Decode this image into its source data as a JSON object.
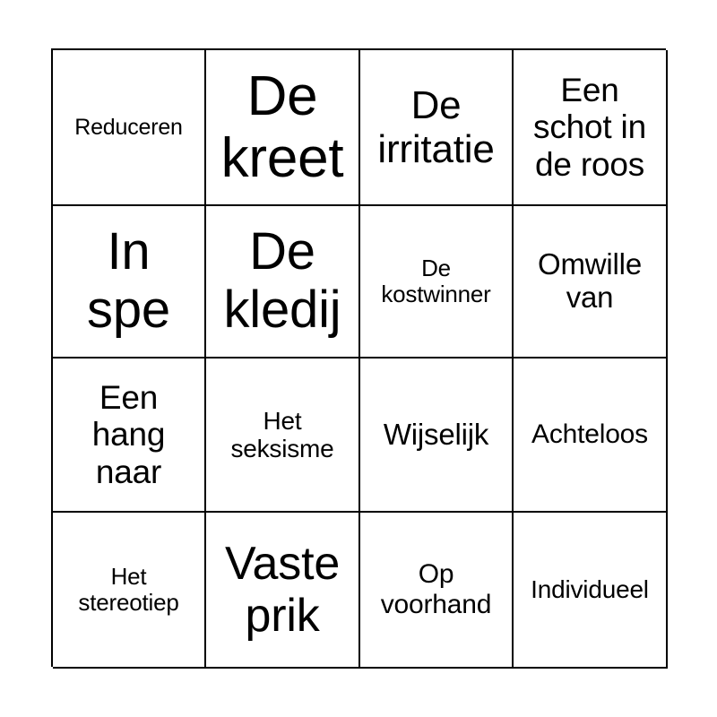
{
  "card": {
    "type": "bingo-card",
    "columns": 4,
    "rows": 4,
    "background_color": "#ffffff",
    "border_color": "#000000",
    "text_color": "#000000",
    "cells": [
      {
        "text": "Reduceren",
        "size": "s-xs",
        "row": 1,
        "col": 1
      },
      {
        "text": "De\nkreet",
        "size": "s-4xl",
        "row": 1,
        "col": 2
      },
      {
        "text": "De\nirritatie",
        "size": "s-xl",
        "row": 1,
        "col": 3
      },
      {
        "text": "Een\nschot in\nde roos",
        "size": "s-lg",
        "row": 1,
        "col": 4
      },
      {
        "text": "In\nspe",
        "size": "s-3xl",
        "row": 2,
        "col": 1
      },
      {
        "text": "De\nkledij",
        "size": "s-3xl",
        "row": 2,
        "col": 2
      },
      {
        "text": "De\nkostwinner",
        "size": "s-sm",
        "row": 2,
        "col": 3
      },
      {
        "text": "Omwille\nvan",
        "size": "s-mdb",
        "row": 2,
        "col": 4
      },
      {
        "text": "Een\nhang\nnaar",
        "size": "s-lg",
        "row": 3,
        "col": 1
      },
      {
        "text": "Het\nseksisme",
        "size": "s-smb",
        "row": 3,
        "col": 2
      },
      {
        "text": "Wijselijk",
        "size": "s-mdb",
        "row": 3,
        "col": 3
      },
      {
        "text": "Achteloos",
        "size": "s-md",
        "row": 3,
        "col": 4
      },
      {
        "text": "Het\nstereotiep",
        "size": "s-sm",
        "row": 4,
        "col": 1
      },
      {
        "text": "Vaste\nprik",
        "size": "s-2xl",
        "row": 4,
        "col": 2
      },
      {
        "text": "Op\nvoorhand",
        "size": "s-md",
        "row": 4,
        "col": 3
      },
      {
        "text": "Individueel",
        "size": "s-smb",
        "row": 4,
        "col": 4
      }
    ]
  }
}
